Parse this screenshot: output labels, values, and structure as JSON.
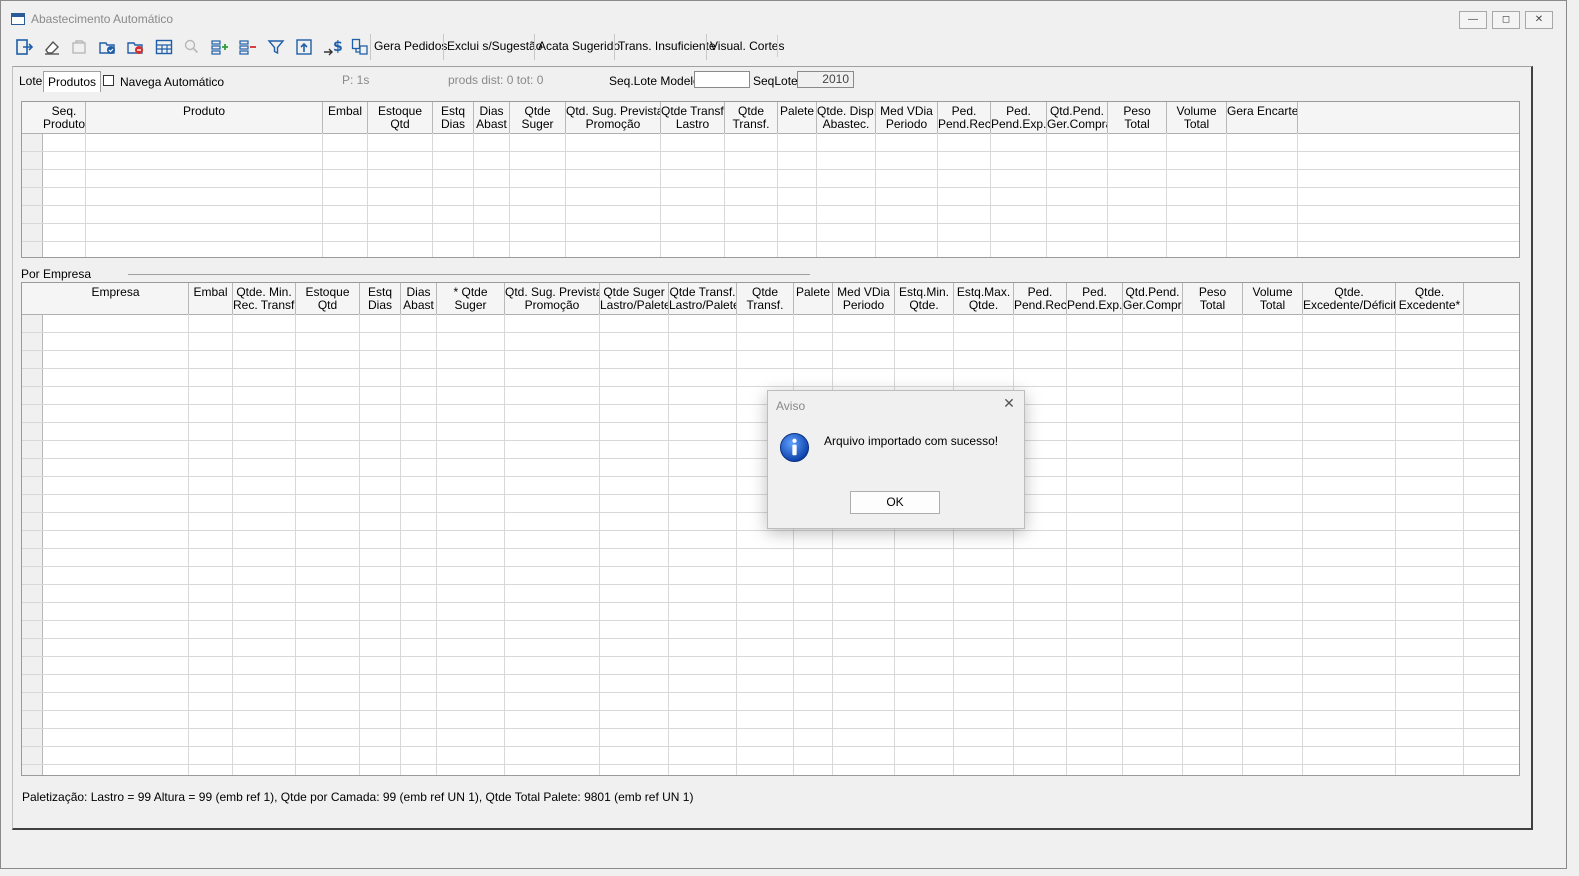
{
  "window": {
    "title": "Abastecimento Automático"
  },
  "toolbar": {
    "icons": [
      "exit-icon",
      "eraser-icon",
      "copy-icon",
      "folder-check-icon",
      "delete-icon",
      "table-icon",
      "search-icon",
      "add-list-icon",
      "remove-list-icon",
      "filter-icon",
      "upload-icon",
      "money-transfer-icon",
      "document-link-icon"
    ],
    "buttons": [
      "Gera Pedidos",
      "Exclui s/Sugestão",
      "Acata Sugerido",
      "Trans. Insuficiente",
      "Visual. Cortes"
    ]
  },
  "tabs": {
    "lote": "Lote",
    "produtos": "Produtos"
  },
  "options": {
    "navega": "Navega Automático"
  },
  "info": {
    "p": "P: 1s",
    "prods": "prods dist: 0  tot: 0"
  },
  "seq": {
    "lote_modelo_label": "Seq.Lote Modelo",
    "lote_modelo_value": "",
    "lote_label": "SeqLote",
    "lote_value": "2010"
  },
  "grid1": {
    "columns": [
      [
        "Seq.",
        "Produto"
      ],
      [
        "Produto"
      ],
      [
        "Embal"
      ],
      [
        "Estoque",
        "Qtd"
      ],
      [
        "Estq",
        "Dias"
      ],
      [
        "Dias",
        "Abast"
      ],
      [
        "Qtde",
        "Suger"
      ],
      [
        "Qtd. Sug. Prevista",
        "Promoção"
      ],
      [
        "Qtde Transf.",
        "Lastro"
      ],
      [
        "Qtde",
        "Transf."
      ],
      [
        "Palete"
      ],
      [
        "Qtde. Disp.",
        "Abastec."
      ],
      [
        "Med VDia",
        "Periodo"
      ],
      [
        "Ped.",
        "Pend.Rec."
      ],
      [
        "Ped.",
        "Pend.Exp."
      ],
      [
        "Qtd.Pend.",
        "Ger.Compra"
      ],
      [
        "Peso",
        "Total"
      ],
      [
        "Volume",
        "Total"
      ],
      [
        "Gera Encarte"
      ]
    ]
  },
  "section": {
    "por_empresa": "Por Empresa"
  },
  "grid2": {
    "columns": [
      [
        "Empresa"
      ],
      [
        "Embal"
      ],
      [
        "Qtde. Min.",
        "Rec. Transf."
      ],
      [
        "Estoque",
        "Qtd"
      ],
      [
        "Estq",
        "Dias"
      ],
      [
        "Dias",
        "Abast"
      ],
      [
        "* Qtde",
        "Suger"
      ],
      [
        "Qtd. Sug. Prevista",
        "Promoção"
      ],
      [
        "Qtde Suger",
        "Lastro/Palete"
      ],
      [
        "Qtde Transf.",
        "Lastro/Palete"
      ],
      [
        "Qtde",
        "Transf."
      ],
      [
        "Palete"
      ],
      [
        "Med VDia",
        "Periodo"
      ],
      [
        "Estq.Min.",
        "Qtde."
      ],
      [
        "Estq.Max.",
        "Qtde."
      ],
      [
        "Ped.",
        "Pend.Rec."
      ],
      [
        "Ped.",
        "Pend.Exp."
      ],
      [
        "Qtd.Pend.",
        "Ger.Compra"
      ],
      [
        "Peso",
        "Total"
      ],
      [
        "Volume",
        "Total"
      ],
      [
        "Qtde.",
        "Excedente/Déficit*"
      ],
      [
        "Qtde.",
        "Excedente*"
      ]
    ]
  },
  "status": {
    "text": "Paletização: Lastro = 99 Altura = 99 (emb ref 1), Qtde por Camada: 99 (emb ref UN 1), Qtde Total Palete: 9801 (emb ref UN 1)"
  },
  "dialog": {
    "title": "Aviso",
    "message": "Arquivo importado com sucesso!",
    "ok": "OK"
  }
}
